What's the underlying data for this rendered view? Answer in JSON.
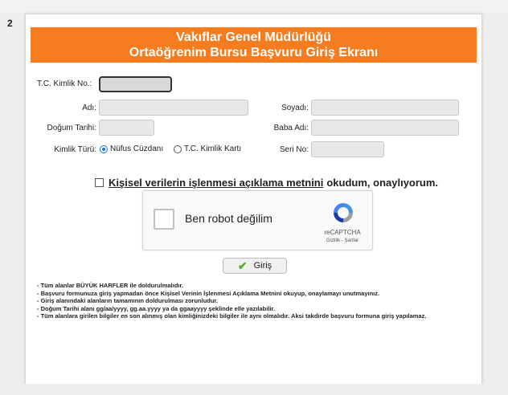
{
  "step_number": "2",
  "header": {
    "title_line1": "Vakıflar Genel Müdürlüğü",
    "title_line2": "Ortaöğrenim Bursu Başvuru Giriş Ekranı"
  },
  "form": {
    "tc_label": "T.C. Kimlik No.:",
    "tc_value": "",
    "name_label": "Adı:",
    "surname_label": "Soyadı:",
    "birth_label": "Doğum Tarihi:",
    "father_label": "Baba Adı:",
    "id_type_label": "Kimlik Türü:",
    "id_type_options": [
      "Nüfus Cüzdanı",
      "T.C. Kimlik Kartı"
    ],
    "id_type_selected": "Nüfus Cüzdanı",
    "serial_label": "Seri No:"
  },
  "consent": {
    "link_text": "Kişisel verilerin işlenmesi açıklama metnini",
    "rest_text": "okudum, onaylıyorum.",
    "checked": false
  },
  "captcha": {
    "label": "Ben robot değilim",
    "brand": "reCAPTCHA",
    "links": "Gizlilik - Şartlar"
  },
  "submit": {
    "label": "Giriş"
  },
  "notes": [
    "- Tüm alanlar BÜYÜK HARFLER ile doldurulmalıdır.",
    "- Başvuru formunuza giriş yapmadan önce Kişisel Verinin İşlenmesi Açıklama Metnini okuyup, onaylamayı unutmayınız.",
    "- Giriş alanındaki alanların tamamının doldurulması zorunludur.",
    "- Doğum Tarihi alanı gg/aa/yyyy, gg.aa.yyyy ya da ggaayyyy şeklinde elle yazılabilir.",
    "- Tüm alanlara girilen bilgiler en son alınmış olan kimliğinizdeki bilgiler ile aynı olmalıdır. Aksi takdirde başvuru formuna giriş yapılamaz."
  ],
  "colors": {
    "header_bg": "#f57c1f",
    "radio_accent": "#1a73e8",
    "check_green": "#4caf2f"
  },
  "icons": {
    "submit_icon": "check-icon",
    "captcha_logo": "recaptcha-logo-icon"
  }
}
